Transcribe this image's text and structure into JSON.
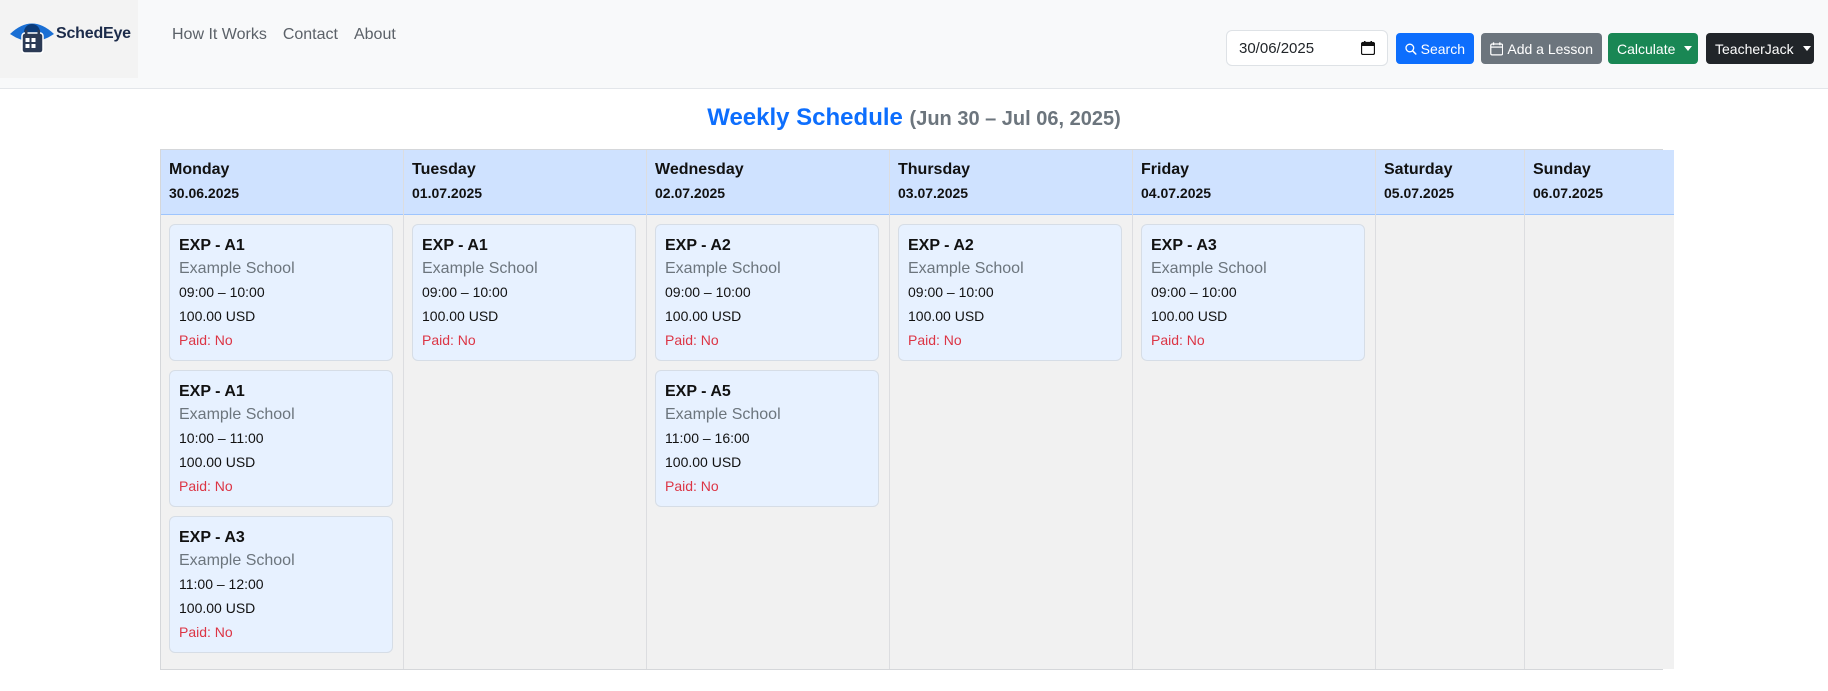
{
  "brand": {
    "name": "SchedEye"
  },
  "nav": {
    "links": [
      "How It Works",
      "Contact",
      "About"
    ]
  },
  "toolbar": {
    "date_value": "30/06/2025",
    "search_label": "Search",
    "add_lesson_label": "Add a Lesson",
    "calculate_label": "Calculate",
    "user_label": "TeacherJack"
  },
  "page": {
    "title": "Weekly Schedule",
    "range": "(Jun 30 – Jul 06, 2025)"
  },
  "days": [
    {
      "name": "Monday",
      "date": "30.06.2025",
      "lessons": [
        {
          "title": "EXP - A1",
          "school": "Example School",
          "time": "09:00 – 10:00",
          "price": "100.00 USD",
          "paid": "Paid: No"
        },
        {
          "title": "EXP - A1",
          "school": "Example School",
          "time": "10:00 – 11:00",
          "price": "100.00 USD",
          "paid": "Paid: No"
        },
        {
          "title": "EXP - A3",
          "school": "Example School",
          "time": "11:00 – 12:00",
          "price": "100.00 USD",
          "paid": "Paid: No"
        }
      ]
    },
    {
      "name": "Tuesday",
      "date": "01.07.2025",
      "lessons": [
        {
          "title": "EXP - A1",
          "school": "Example School",
          "time": "09:00 – 10:00",
          "price": "100.00 USD",
          "paid": "Paid: No"
        }
      ]
    },
    {
      "name": "Wednesday",
      "date": "02.07.2025",
      "lessons": [
        {
          "title": "EXP - A2",
          "school": "Example School",
          "time": "09:00 – 10:00",
          "price": "100.00 USD",
          "paid": "Paid: No"
        },
        {
          "title": "EXP - A5",
          "school": "Example School",
          "time": "11:00 – 16:00",
          "price": "100.00 USD",
          "paid": "Paid: No"
        }
      ]
    },
    {
      "name": "Thursday",
      "date": "03.07.2025",
      "lessons": [
        {
          "title": "EXP - A2",
          "school": "Example School",
          "time": "09:00 – 10:00",
          "price": "100.00 USD",
          "paid": "Paid: No"
        }
      ]
    },
    {
      "name": "Friday",
      "date": "04.07.2025",
      "lessons": [
        {
          "title": "EXP - A3",
          "school": "Example School",
          "time": "09:00 – 10:00",
          "price": "100.00 USD",
          "paid": "Paid: No"
        }
      ]
    },
    {
      "name": "Saturday",
      "date": "05.07.2025",
      "lessons": []
    },
    {
      "name": "Sunday",
      "date": "06.07.2025",
      "lessons": []
    }
  ],
  "colors": {
    "primary": "#0d6efd",
    "secondary": "#6c757d",
    "success": "#198754",
    "dark": "#212529",
    "danger": "#dc3545",
    "header_bg": "#cfe2ff",
    "card_bg": "#e7f1ff"
  },
  "icons": {
    "logo": "eye-calendar-logo-icon",
    "date_picker": "calendar-icon",
    "search": "search-icon",
    "add_lesson": "calendar-icon",
    "dropdown": "chevron-down-icon"
  }
}
